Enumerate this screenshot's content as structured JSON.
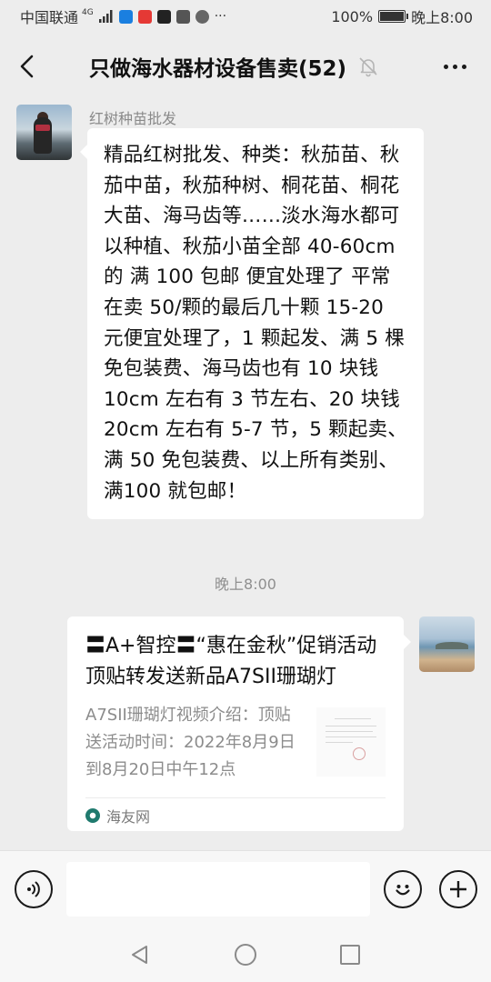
{
  "status_bar": {
    "carrier": "中国联通",
    "network": "4G",
    "battery": "100%",
    "battery_level": 1.0,
    "time": "晚上8:00"
  },
  "header": {
    "title": "只做海水器材设备售卖(52)"
  },
  "messages": [
    {
      "sender": "红树种苗批发",
      "type": "text",
      "text": "精品红树批发、种类：秋茄苗、秋茄中苗，秋茄种树、桐花苗、桐花大苗、海马齿等……淡水海水都可以种植、秋茄小苗全部 40-60cm 的 满 100 包邮 便宜处理了 平常在卖 50/颗的最后几十颗 15-20 元便宜处理了，1 颗起发、满 5 棵免包装费、海马齿也有 10 块钱 10cm 左右有 3 节左右、20 块钱 20cm 左右有 5-7 节，5 颗起卖、满 50 免包装费、以上所有类别、满100 就包邮！"
    },
    {
      "type": "timestamp",
      "text": "晚上8:00"
    },
    {
      "type": "link",
      "title": "〓A+智控〓“惠在金秋”促销活动顶贴转发送新品A7SII珊瑚灯",
      "description": "A7SII珊瑚灯视频介绍：顶贴送活动时间：2022年8月9日到8月20日中午12点",
      "source": "海友网"
    }
  ],
  "input_bar": {
    "placeholder": ""
  },
  "colors": {
    "background": "#ededed",
    "bubble": "#ffffff",
    "secondary_text": "#8a8a8a"
  },
  "icons": [
    "back-arrow-icon",
    "mute-bell-icon",
    "more-icon",
    "voice-icon",
    "emoji-icon",
    "plus-icon",
    "nav-back-icon",
    "nav-home-icon",
    "nav-recent-icon"
  ]
}
